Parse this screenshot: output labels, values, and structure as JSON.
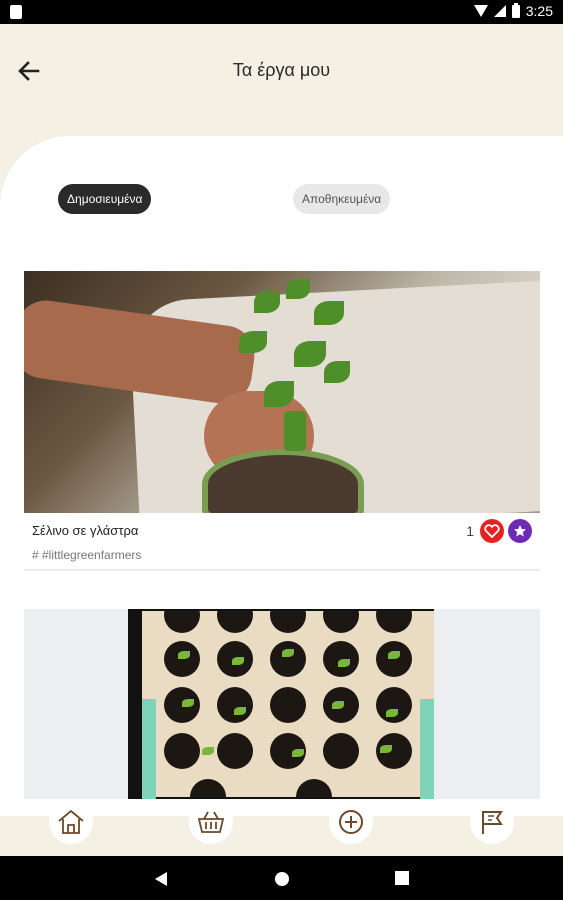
{
  "status_bar": {
    "time": "3:25"
  },
  "header": {
    "title": "Τα έργα μου"
  },
  "tabs": [
    {
      "label": "Δημοσιευμένα",
      "active": true
    },
    {
      "label": "Αποθηκευμένα",
      "active": false
    }
  ],
  "posts": [
    {
      "title": "Σέλινο σε γλάστρα",
      "tag": "# #littlegreenfarmers",
      "likes": "1",
      "image": "celery-plant-in-pot-photo"
    },
    {
      "image": "seedling-tray-photo"
    }
  ],
  "bottom_nav": [
    {
      "name": "home",
      "icon": "home-icon"
    },
    {
      "name": "market",
      "icon": "basket-icon"
    },
    {
      "name": "add",
      "icon": "plus-circle-icon"
    },
    {
      "name": "projects",
      "icon": "flag-icon"
    }
  ],
  "colors": {
    "background": "#f4f0e3",
    "heart": "#e52222",
    "star": "#6d2bb3",
    "active_tab": "#2a2a2a"
  }
}
